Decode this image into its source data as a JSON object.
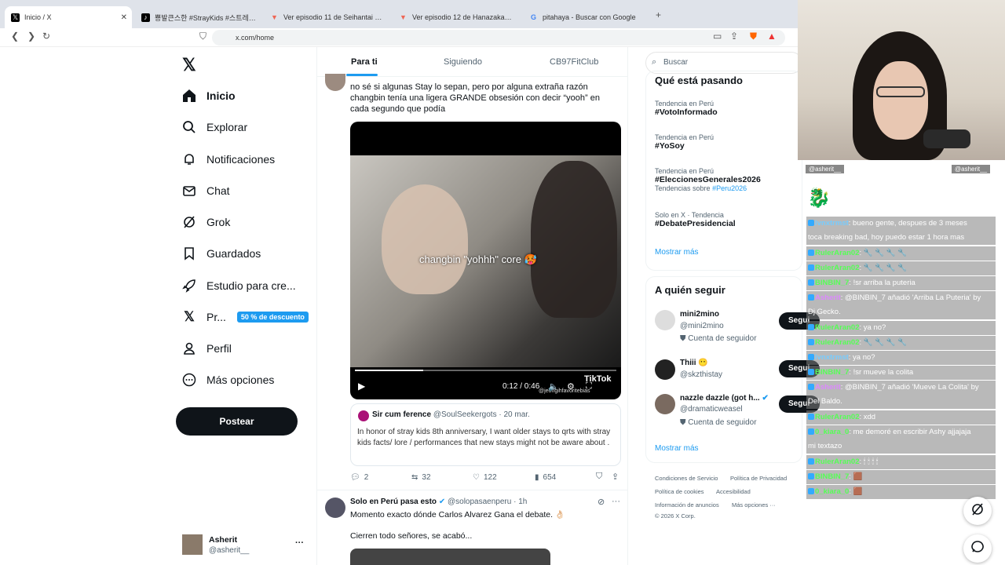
{
  "browser": {
    "tabs": [
      {
        "label": "Inicio / X",
        "icon": "x-logo-icon",
        "active": true
      },
      {
        "label": "뿅발큰스한 #StrayKids #스트레이키즈",
        "icon": "tiktok-icon"
      },
      {
        "label": "Ver episodio 11 de Seihantai na Kimi",
        "icon": "crunchy-icon"
      },
      {
        "label": "Ver episodio 12 de Hanazakari no Kimi",
        "icon": "crunchy-icon"
      },
      {
        "label": "pitahaya - Buscar con Google",
        "icon": "google-icon"
      }
    ],
    "url": "x.com/home"
  },
  "nav": {
    "items": [
      {
        "label": "Inicio",
        "icon": "home-icon"
      },
      {
        "label": "Explorar",
        "icon": "search-icon"
      },
      {
        "label": "Notificaciones",
        "icon": "bell-icon"
      },
      {
        "label": "Chat",
        "icon": "mail-icon"
      },
      {
        "label": "Grok",
        "icon": "grok-icon"
      },
      {
        "label": "Guardados",
        "icon": "bookmark-icon"
      },
      {
        "label": "Estudio para cre...",
        "icon": "rocket-icon"
      },
      {
        "label": "Pr...",
        "icon": "x-premium-icon"
      },
      {
        "label": "Perfil",
        "icon": "person-icon"
      },
      {
        "label": "Más opciones",
        "icon": "more-circle-icon"
      }
    ],
    "promo_badge": "50 % de descuento",
    "post_button": "Postear",
    "account": {
      "name": "Asherit",
      "handle": "@asherit__"
    }
  },
  "feed": {
    "tabs": [
      "Para ti",
      "Siguiendo",
      "CB97FitClub"
    ],
    "post1": {
      "text": "no sé si algunas Stay lo sepan, pero por alguna extraña razón changbin tenía una ligera GRANDE obsesión con decir “yooh” en cada segundo que podía",
      "video_caption": "changbin \"yohhh\" core 🥵",
      "video_time": "0:12 / 0:46",
      "video_watermark": "TikTok",
      "video_handle": "@jeongihfavoritebias",
      "quoted": {
        "name": "Sir cum ference",
        "handle": "@SoulSeekergots",
        "date": "· 20 mar.",
        "text": "In honor of stray kids 8th anniversary, I want older stays to qrts with stray kids facts/ lore / performances that new stays might not be aware about ."
      },
      "stats": {
        "replies": "2",
        "reposts": "32",
        "likes": "122",
        "views": "654"
      }
    },
    "post2": {
      "name": "Solo en Perú pasa esto",
      "handle": "@solopasaenperu",
      "time": "· 1h",
      "text": "Momento exacto dónde Carlos Alvarez Gana el debate. 👌🏻",
      "text2": "Cierren todo señores, se acabó..."
    }
  },
  "sidebar": {
    "search_placeholder": "Buscar",
    "trends_title": "Qué está pasando",
    "trends": [
      {
        "meta": "Tendencia en Perú",
        "tag": "#VotoInformado"
      },
      {
        "meta": "Tendencia en Perú",
        "tag": "#YoSoy"
      },
      {
        "meta": "Tendencia en Perú",
        "tag": "#EleccionesGenerales2026",
        "sub": "Tendencias sobre",
        "sublink": "#Peru2026"
      },
      {
        "meta": "Solo en X · Tendencia",
        "tag": "#DebatePresidencial"
      }
    ],
    "show_more": "Mostrar más",
    "who_to_follow": "A quién seguir",
    "follows": [
      {
        "name": "mini2mino",
        "handle": "@mini2mino",
        "note": "Cuenta de seguidor"
      },
      {
        "name": "Thiii 😶",
        "handle": "@skzthistay",
        "note": ""
      },
      {
        "name": "nazzle dazzle (got h...",
        "handle": "@dramaticweasel",
        "note": "Cuenta de seguidor"
      }
    ],
    "follow_label": "Segui",
    "show_more2": "Mostrar más",
    "footer": [
      "Condiciones de Servicio",
      "Política de Privacidad",
      "Política de cookies",
      "Accesibilidad",
      "Información de anuncios",
      "Más opciones ···",
      "© 2026 X Corp."
    ]
  },
  "stream": {
    "header_left": "@asherit__",
    "header_right": "@asherit__",
    "chat": [
      {
        "user": "lvnxtrmst",
        "msg": ": bueno gente, despues de 3 meses",
        "cont": "toca breaking bad, hoy puedo estar 1 hora mas",
        "color": "user"
      },
      {
        "user": "RulerAran02",
        "msg": ": 🔧 🔧 🔧 🔧",
        "color": "user g"
      },
      {
        "user": "RulerAran02",
        "msg": ": 🔧 🔧 🔧 🔧",
        "color": "user g"
      },
      {
        "user": "BINBIN_7",
        "msg": ": !sr arriba la puteria",
        "color": "user g"
      },
      {
        "user": "Asherit",
        "msg": ": @BINBIN_7 añadió 'Arriba La Puteria' by",
        "cont": "Dj Gecko.",
        "color": "user p"
      },
      {
        "user": "RulerAran02",
        "msg": ": ya no?",
        "color": "user g"
      },
      {
        "user": "RulerAran02",
        "msg": ": 🔧 🔧 🔧 🔧",
        "color": "user g"
      },
      {
        "user": "lvnxtrmst",
        "msg": ": ya no?",
        "color": "user"
      },
      {
        "user": "BINBIN_7",
        "msg": ": !sr mueve la colita",
        "color": "user g"
      },
      {
        "user": "Asherit",
        "msg": ": @BINBIN_7 añadió 'Mueve La Colita' by",
        "cont": "Del Baldo.",
        "color": "user p"
      },
      {
        "user": "RulerAran02",
        "msg": ": xdd",
        "color": "user g"
      },
      {
        "user": "0_kiara_0",
        "msg": ": me demoré en escribir Ashy ajjajaja",
        "cont": "mi textazo",
        "color": "user g"
      },
      {
        "user": "RulerAran02",
        "msg": ": 🕯 🕯 🕯 🕯",
        "color": "user g"
      },
      {
        "user": "BINBIN_7",
        "msg": ": 🟫",
        "color": "user g"
      },
      {
        "user": "0_kiara_0",
        "msg": ": 🟫",
        "color": "user g"
      }
    ]
  }
}
